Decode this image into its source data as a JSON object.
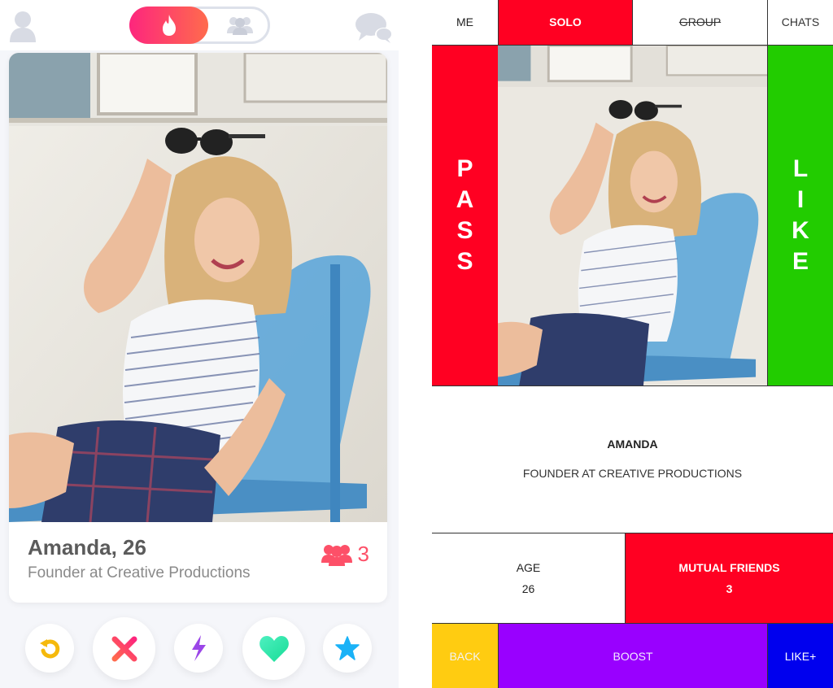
{
  "left_app": {
    "header": {
      "profile_icon": "person-icon",
      "mode_toggle": {
        "solo_icon": "flame-icon",
        "group_icon": "group-icon",
        "selected": "solo"
      },
      "chat_icon": "chat-bubbles-icon"
    },
    "card": {
      "photo_alt": "Amanda smiling, holding sunglasses on her head, seated in a blue chair",
      "name_age": "Amanda, 26",
      "job": "Founder at Creative Productions",
      "mutual_friends_icon": "group-icon",
      "mutual_friends_count": "3"
    },
    "actions": [
      {
        "name": "rewind",
        "icon": "rewind-icon",
        "color": "#f5b90c"
      },
      {
        "name": "nope",
        "icon": "close-icon",
        "color": "#fd4e6a"
      },
      {
        "name": "boost",
        "icon": "lightning-icon",
        "color": "#9b46e8"
      },
      {
        "name": "like",
        "icon": "heart-icon",
        "color": "#27e0a8"
      },
      {
        "name": "super-like",
        "icon": "star-icon",
        "color": "#1ab2f7"
      }
    ],
    "colors": {
      "brand_gradient_start": "#fd267d",
      "brand_gradient_end": "#ff6b4d",
      "muted_icon": "#d8dbe4"
    }
  },
  "right_wireframe": {
    "nav": {
      "me": "ME",
      "solo": "SOLO",
      "group": "GROUP",
      "chats": "CHATS"
    },
    "pass_label": [
      "P",
      "A",
      "S",
      "S"
    ],
    "like_label": [
      "L",
      "I",
      "K",
      "E"
    ],
    "profile": {
      "name": "AMANDA",
      "job": "FOUNDER AT CREATIVE PRODUCTIONS"
    },
    "stats": {
      "age_label": "AGE",
      "age_value": "26",
      "mutual_label": "MUTUAL FRIENDS",
      "mutual_value": "3"
    },
    "bottom": {
      "back": "BACK",
      "boost": "BOOST",
      "like_plus": "LIKE+"
    },
    "colors": {
      "red": "#ff0022",
      "green": "#22cc00",
      "yellow": "#ffcc11",
      "purple": "#9900ff",
      "blue": "#0000ee"
    }
  }
}
